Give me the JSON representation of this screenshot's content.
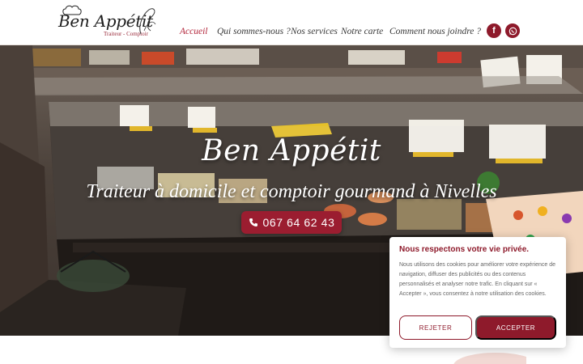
{
  "header": {
    "logo": {
      "name": "Ben Appétit",
      "tagline": "Traiteur - Comptoir"
    },
    "nav": [
      {
        "label": "Accueil",
        "active": true
      },
      {
        "label": "Qui sommes-nous ?",
        "active": false
      },
      {
        "label": "Nos services",
        "active": false
      },
      {
        "label": "Notre carte",
        "active": false
      },
      {
        "label": "Comment nous joindre ?",
        "active": false
      }
    ],
    "social": [
      {
        "icon": "facebook-icon",
        "glyph": "f"
      },
      {
        "icon": "whatsapp-icon"
      }
    ]
  },
  "hero": {
    "title": "Ben Appétit",
    "subtitle": "Traiteur à domicile et comptoir gourmand à Nivelles",
    "phone": "067 64 62 43",
    "phone_icon": "phone-icon"
  },
  "cookie_banner": {
    "title": "Nous respectons votre vie privée.",
    "text": "Nous utilisons des cookies pour améliorer votre expérience de navigation, diffuser des publicités ou des contenus personnalisés et analyser notre trafic. En cliquant sur « Accepter », vous consentez à notre utilisation des cookies.",
    "reject_label": "REJETER",
    "accept_label": "ACCEPTER"
  },
  "colors": {
    "brand": "#8e1a2b",
    "nav_active": "#b3263b",
    "text": "#3a3a3a"
  }
}
